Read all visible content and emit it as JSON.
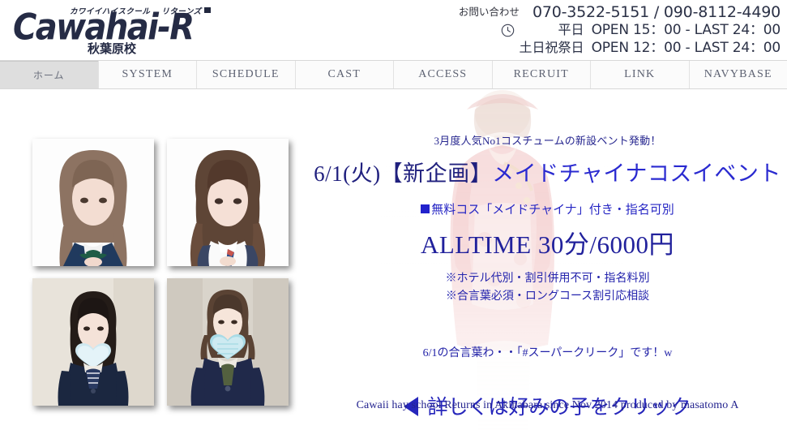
{
  "site": {
    "logo_kana_left": "カワイイハイスクール",
    "logo_kana_right": "リターンズ",
    "logo_main": "Cawahai-R",
    "logo_sub": "秋葉原校"
  },
  "header": {
    "contact_label": "お問い合わせ",
    "phone": "070-3522-5151 / 090-8112-4490",
    "clock_icon": "clock-icon",
    "weekday_label": "平日",
    "weekday_hours": "OPEN 15：00 - LAST 24：00",
    "weekend_label": "土日祝祭日",
    "weekend_hours": "OPEN 12：00 - LAST 24：00"
  },
  "nav": {
    "items": [
      {
        "label": "ホーム",
        "active": true
      },
      {
        "label": "SYSTEM",
        "active": false
      },
      {
        "label": "SCHEDULE",
        "active": false
      },
      {
        "label": "CAST",
        "active": false
      },
      {
        "label": "ACCESS",
        "active": false
      },
      {
        "label": "RECRUIT",
        "active": false
      },
      {
        "label": "LINK",
        "active": false
      },
      {
        "label": "NAVYBASE",
        "active": false
      }
    ]
  },
  "gallery": {
    "photos": [
      {
        "name": "cast-photo-1",
        "alt": "制服姿のキャスト写真1"
      },
      {
        "name": "cast-photo-2",
        "alt": "制服姿のキャスト写真2"
      },
      {
        "name": "cast-photo-3",
        "alt": "制服姿のキャスト写真3"
      },
      {
        "name": "cast-photo-4",
        "alt": "制服姿のキャスト写真4"
      }
    ]
  },
  "promo": {
    "kicker": "3月度人気No1コスチュームの新設ベント発動！",
    "title_date": "6/1(火)",
    "title_tag": "【新企画】",
    "title_event": "メイドチャイナコスイベント",
    "free_costume": "無料コス「メイドチャイナ」付き・指名可別",
    "price": "ALLTIME 30分/6000円",
    "note_line1": "※ホテル代別・割引併用不可・指名料別",
    "note_line2": "※合言葉必須・ロングコース割引応相談",
    "password_line": "6/1の合言葉わ・・「#スーパークリーク」です！w",
    "cta": "詳しくは好みの子をクリック",
    "cta_icon": "triangle-left-icon",
    "footer": "Cawaii hay school Returns in Akihabara since Nov 2014 produced by masatomo A"
  },
  "colors": {
    "brand_navy": "#252b45",
    "promo_blue": "#2222cc",
    "nav_active_bg": "#dedede",
    "nav_text": "#5d6272"
  }
}
